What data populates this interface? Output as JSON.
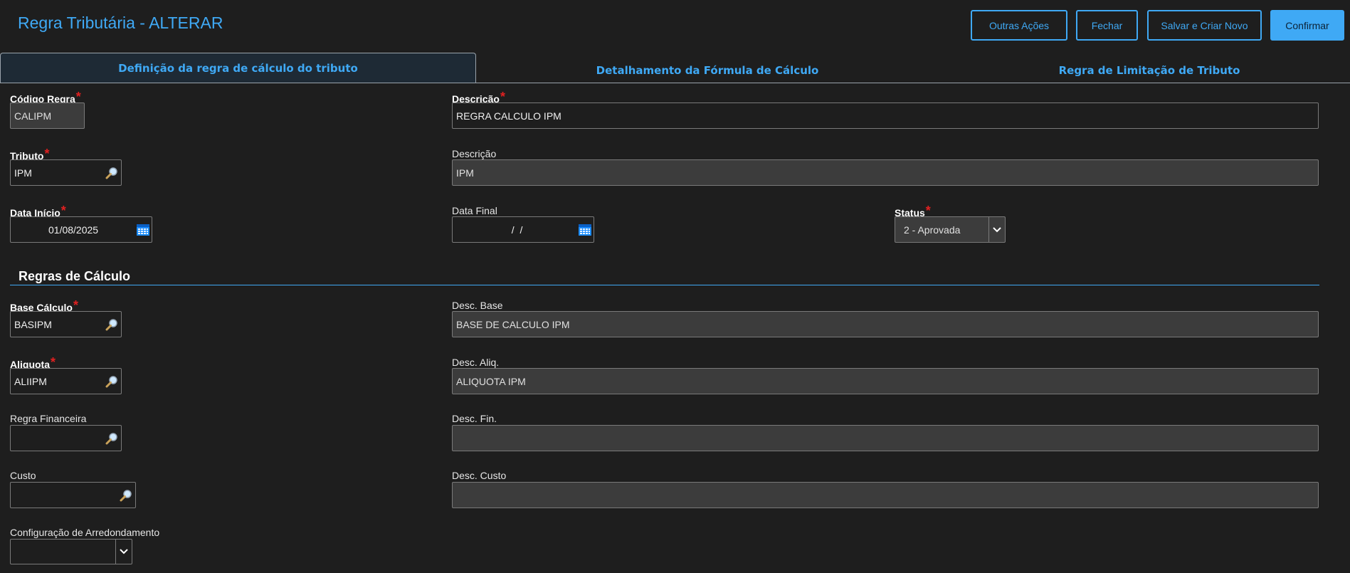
{
  "header": {
    "title": "Regra Tributária - ALTERAR",
    "buttons": {
      "outras_acoes": "Outras Ações",
      "fechar": "Fechar",
      "salvar_criar_novo": "Salvar e Criar Novo",
      "confirmar": "Confirmar"
    }
  },
  "tabs": [
    {
      "label": "Definição da regra de cálculo do tributo",
      "active": true
    },
    {
      "label": "Detalhamento da Fórmula de Cálculo",
      "active": false
    },
    {
      "label": "Regra de Limitação de Tributo",
      "active": false
    }
  ],
  "form": {
    "codigo_regra": {
      "label": "Código Regra",
      "value": "CALIPM"
    },
    "descricao": {
      "label": "Descrição",
      "value": "REGRA CALCULO IPM"
    },
    "tributo": {
      "label": "Tributo",
      "value": "IPM"
    },
    "descricao_tributo": {
      "label": "Descrição",
      "value": "IPM"
    },
    "data_inicio": {
      "label": "Data Início",
      "value": "01/08/2025"
    },
    "data_final": {
      "label": "Data Final",
      "value": "  /  /"
    },
    "status": {
      "label": "Status",
      "value": "2 - Aprovada"
    }
  },
  "section": {
    "title": "Regras de Cálculo"
  },
  "calc": {
    "base_calculo": {
      "label": "Base Cálculo",
      "value": "BASIPM"
    },
    "desc_base": {
      "label": "Desc. Base",
      "value": "BASE DE CALCULO IPM"
    },
    "aliquota": {
      "label": "Aliquota",
      "value": "ALIIPM"
    },
    "desc_aliq": {
      "label": "Desc. Aliq.",
      "value": "ALIQUOTA IPM"
    },
    "regra_financeira": {
      "label": "Regra Financeira",
      "value": ""
    },
    "desc_fin": {
      "label": "Desc. Fin.",
      "value": ""
    },
    "custo": {
      "label": "Custo",
      "value": ""
    },
    "desc_custo": {
      "label": "Desc. Custo",
      "value": ""
    },
    "config_arred": {
      "label": "Configuração de Arredondamento",
      "value": ""
    }
  },
  "icons": {
    "lookup": "magnifier-icon",
    "calendar": "calendar-icon",
    "dropdown": "chevron-down-icon"
  },
  "colors": {
    "accent": "#3fa9f5",
    "required": "#e02020",
    "background": "#1e1e1e",
    "readonly": "#3c3c3c"
  }
}
